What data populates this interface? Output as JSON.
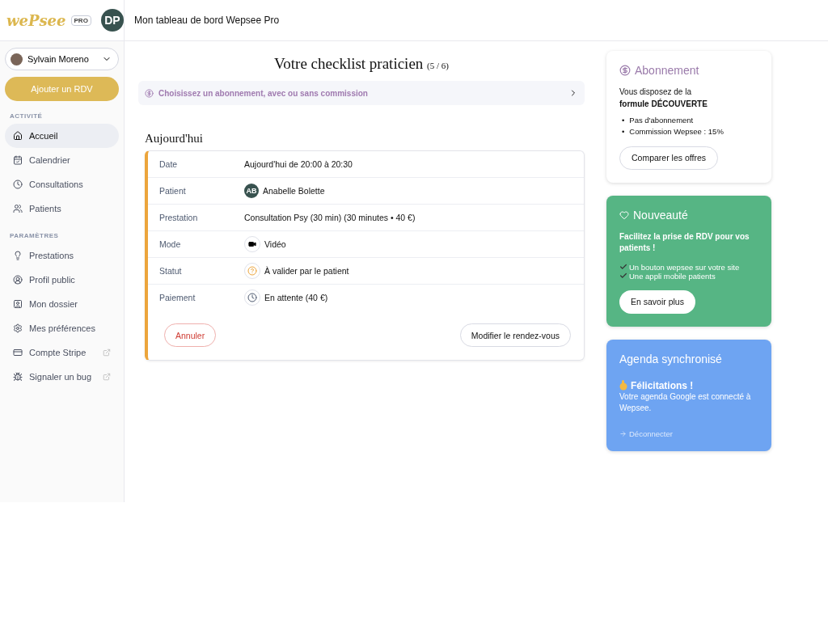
{
  "header": {
    "logo": "wePsee",
    "badge": "PRO",
    "avatar": "DP",
    "title": "Mon tableau de bord Wepsee Pro"
  },
  "sidebar": {
    "user": "Sylvain Moreno",
    "add_button": "Ajouter un RDV",
    "sections": [
      {
        "title": "ACTIVITÉ",
        "items": [
          {
            "label": "Accueil",
            "kind": "home",
            "selected": true,
            "external": false
          },
          {
            "label": "Calendrier",
            "kind": "calendar",
            "selected": false,
            "external": false
          },
          {
            "label": "Consultations",
            "kind": "clock",
            "selected": false,
            "external": false
          },
          {
            "label": "Patients",
            "kind": "users",
            "selected": false,
            "external": false
          }
        ]
      },
      {
        "title": "PARAMÈTRES",
        "items": [
          {
            "label": "Prestations",
            "kind": "bulb",
            "selected": false,
            "external": false
          },
          {
            "label": "Profil public",
            "kind": "profile",
            "selected": false,
            "external": false
          },
          {
            "label": "Mon dossier",
            "kind": "folder",
            "selected": false,
            "external": false
          },
          {
            "label": "Mes préférences",
            "kind": "gear",
            "selected": false,
            "external": false
          },
          {
            "label": "Compte Stripe",
            "kind": "card",
            "selected": false,
            "external": true
          },
          {
            "label": "Signaler un bug",
            "kind": "bug",
            "selected": false,
            "external": true
          }
        ]
      }
    ]
  },
  "checklist": {
    "title": "Votre checklist praticien",
    "count": "(5 / 6)",
    "step": "Choisissez un abonnement, avec ou sans commission"
  },
  "today": {
    "title": "Aujourd'hui",
    "rows": [
      {
        "label": "Date",
        "value": "Aujourd'hui de 20:00 à 20:30",
        "kind": "plain"
      },
      {
        "label": "Patient",
        "value": "Anabelle Bolette",
        "kind": "avatar",
        "initials": "AB"
      },
      {
        "label": "Prestation",
        "value": "Consultation Psy (30 min) (30 minutes • 40 €)",
        "kind": "plain"
      },
      {
        "label": "Mode",
        "value": "Vidéo",
        "kind": "video"
      },
      {
        "label": "Statut",
        "value": "À valider par le patient",
        "kind": "question"
      },
      {
        "label": "Paiement",
        "value": "En attente (40 €)",
        "kind": "clock"
      }
    ],
    "cancel": "Annuler",
    "edit": "Modifier le rendez-vous"
  },
  "subscription": {
    "title": "Abonnement",
    "intro": "Vous disposez de la",
    "plan": "formule DÉCOUVERTE",
    "bullets": [
      {
        "marker": "•",
        "text": "Pas d'abonnement"
      },
      {
        "marker": "•",
        "text": "Commission Wepsee : 15%"
      }
    ],
    "button": "Comparer les offres"
  },
  "news": {
    "title": "Nouveauté",
    "lead": "Facilitez la prise de RDV pour vos patients !",
    "checks": [
      "Un bouton wepsee sur votre site",
      "Une appli mobile patients"
    ],
    "button": "En savoir plus"
  },
  "agenda": {
    "title": "Agenda synchronisé",
    "heading": "Félicitations !",
    "text": "Votre agenda Google est connecté à Wepsee.",
    "link": "Déconnecter"
  }
}
